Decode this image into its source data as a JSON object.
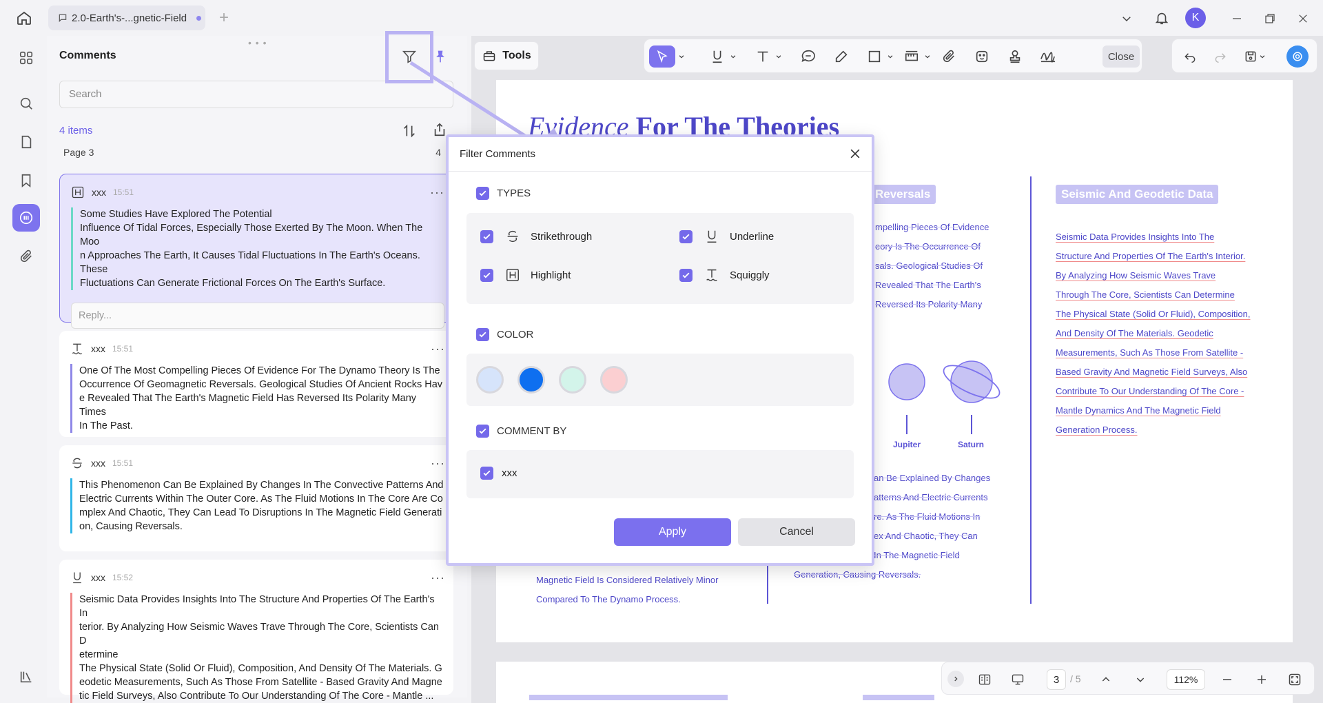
{
  "app": {
    "tab_title": "2.0-Earth's-...gnetic-Field",
    "avatar_letter": "K"
  },
  "comments_panel": {
    "title": "Comments",
    "search_placeholder": "Search",
    "items_count": "4 items",
    "page_label": "Page 3",
    "page_count": "4",
    "reply_placeholder": "Reply...",
    "comments": [
      {
        "type_icon": "highlight-icon",
        "author": "xxx",
        "time": "15:51",
        "color": "#6dd9c7",
        "lines": [
          "Some Studies Have Explored The Potential",
          "Influence Of Tidal Forces, Especially Those Exerted By The Moon. When The Moo",
          "n Approaches The Earth, It Causes Tidal Fluctuations In The Earth's Oceans. These",
          "Fluctuations Can Generate Frictional Forces On The Earth's Surface."
        ]
      },
      {
        "type_icon": "squiggly-icon",
        "author": "xxx",
        "time": "15:51",
        "color": "#8f88e8",
        "lines": [
          "One Of The Most Compelling Pieces Of Evidence For The Dynamo Theory Is The",
          "Occurrence Of Geomagnetic Reversals. Geological Studies Of Ancient Rocks Hav",
          "e Revealed That The Earth's Magnetic Field Has Reversed Its Polarity Many Times",
          "In The Past."
        ]
      },
      {
        "type_icon": "strikethrough-icon",
        "author": "xxx",
        "time": "15:51",
        "color": "#30b6e8",
        "lines": [
          "This Phenomenon Can Be Explained By Changes In The Convective Patterns And",
          "Electric Currents Within The Outer Core. As The Fluid Motions In The Core Are Co",
          "mplex And Chaotic, They Can Lead To Disruptions In The Magnetic Field Generati",
          "on, Causing Reversals."
        ]
      },
      {
        "type_icon": "underline-icon",
        "author": "xxx",
        "time": "15:52",
        "color": "#f08a8a",
        "lines": [
          "Seismic Data Provides Insights Into The Structure And Properties Of The Earth's In",
          "terior. By Analyzing How Seismic Waves Trave Through The Core, Scientists Can D",
          "etermine",
          "The Physical State (Solid Or Fluid), Composition, And Density Of The Materials. G",
          "eodetic Measurements, Such As Those From Satellite - Based Gravity And Magne",
          "tic Field Surveys, Also Contribute To Our Understanding Of The Core - Mantle ..."
        ]
      }
    ]
  },
  "toolbar": {
    "tools_label": "Tools",
    "close_label": "Close"
  },
  "document": {
    "title_italic": "Evidence",
    "title_rest": "For The Theories",
    "reversals_badge": "Reversals",
    "seismic_badge": "Seismic And Geodetic Data",
    "reversals_lines": [
      "mpelling Pieces Of Evidence",
      "eory Is The Occurrence Of",
      "sals. Geological Studies Of",
      "Revealed That The Earth's",
      "Reversed Its Polarity Many"
    ],
    "seismic_lines": [
      "Seismic Data Provides Insights Into The",
      "Structure And Properties Of The Earth's Interior.",
      "By Analyzing How Seismic Waves Trave",
      "Through The Core, Scientists Can Determine",
      "The Physical State (Solid Or Fluid), Composition,",
      "And Density Of The Materials. Geodetic",
      "Measurements, Such As Those From Satellite -",
      "Based Gravity And Magnetic Field Surveys, Also",
      "Contribute To Our Understanding Of The Core -",
      "Mantle Dynamics And The Magnetic Field",
      "Generation Process."
    ],
    "convective_lines": [
      "an Be Explained By Changes",
      "atterns And Electric Currents",
      "re. As The Fluid Motions In",
      "ex And Chaotic, They Can",
      "In The Magnetic Field",
      "Generation, Causing Reversals."
    ],
    "left_lines": [
      "Magnetic Field Is Considered Relatively Minor",
      "Compared To The Dynamo Process."
    ],
    "planet_jupiter": "Jupiter",
    "planet_saturn": "Saturn"
  },
  "bottom_bar": {
    "current_page": "3",
    "total_pages": "/ 5",
    "zoom": "112%"
  },
  "filter_dialog": {
    "title": "Filter Comments",
    "types_label": "TYPES",
    "types": [
      {
        "label": "Strikethrough",
        "icon": "strikethrough-icon",
        "checked": true
      },
      {
        "label": "Underline",
        "icon": "underline-icon",
        "checked": true
      },
      {
        "label": "Highlight",
        "icon": "highlight-icon",
        "checked": true
      },
      {
        "label": "Squiggly",
        "icon": "squiggly-icon",
        "checked": true
      }
    ],
    "color_label": "COLOR",
    "colors": [
      "#d6e4fb",
      "#0e6ff0",
      "#d3f4ea",
      "#fbcfd1"
    ],
    "comment_by_label": "COMMENT BY",
    "comment_by_user": "xxx",
    "apply_label": "Apply",
    "cancel_label": "Cancel"
  }
}
